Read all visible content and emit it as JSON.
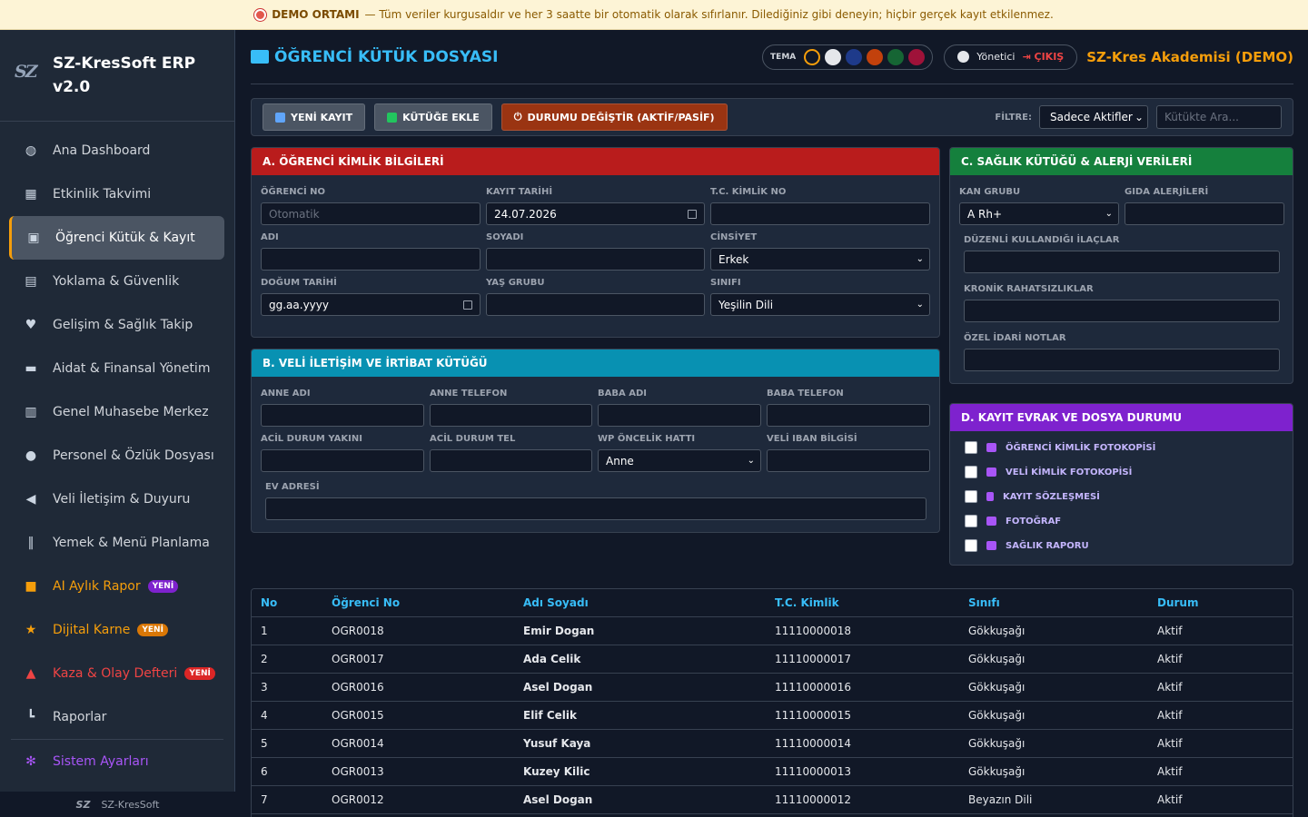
{
  "banner": {
    "title": "DEMO ORTAMI",
    "text": "— Tüm veriler kurgusaldır ve her 3 saatte bir otomatik olarak sıfırlanır. Dilediğiniz gibi deneyin; hiçbir gerçek kayıt etkilenmez."
  },
  "app": {
    "title": "SZ-KresSoft ERP v2.0",
    "footer": "SZ-KresSoft"
  },
  "sidebar": {
    "items": [
      {
        "label": "Ana Dashboard",
        "icon": "dashboard-icon"
      },
      {
        "label": "Etkinlik Takvimi",
        "icon": "calendar-icon"
      },
      {
        "label": "Öğrenci Kütük & Kayıt",
        "icon": "student-icon"
      },
      {
        "label": "Yoklama & Güvenlik",
        "icon": "id-badge-icon"
      },
      {
        "label": "Gelişim & Sağlık Takip",
        "icon": "heartbeat-icon"
      },
      {
        "label": "Aidat & Finansal Yönetim",
        "icon": "money-card-icon"
      },
      {
        "label": "Genel Muhasebe Merkez",
        "icon": "calculator-icon"
      },
      {
        "label": "Personel & Özlük Dosyası",
        "icon": "user-icon"
      },
      {
        "label": "Veli İletişim & Duyuru",
        "icon": "megaphone-icon"
      },
      {
        "label": "Yemek & Menü Planlama",
        "icon": "utensils-icon"
      },
      {
        "label": "AI Aylık Rapor",
        "icon": "robot-icon",
        "badge": "YENİ"
      },
      {
        "label": "Dijital Karne",
        "icon": "star-icon",
        "badge": "YENİ"
      },
      {
        "label": "Kaza & Olay Defteri",
        "icon": "warning-icon",
        "badge": "YENİ"
      },
      {
        "label": "Raporlar",
        "icon": "chart-icon"
      },
      {
        "label": "Sistem Ayarları",
        "icon": "cogs-icon"
      }
    ]
  },
  "header": {
    "title": "ÖĞRENCİ KÜTÜK DOSYASI",
    "theme_label": "TEMA",
    "user": "Yönetici",
    "logout": "ÇIKIŞ",
    "org": "SZ-Kres Akademisi (DEMO)"
  },
  "theme_colors": [
    "#111827",
    "#e5e7eb",
    "#1e3a8a",
    "#c2410c",
    "#166534",
    "#9f1239"
  ],
  "toolbar": {
    "new": "YENİ KAYIT",
    "save": "KÜTÜĞE EKLE",
    "toggle": "DURUMU DEĞİŞTİR (AKTİF/PASİF)",
    "filter_label": "FİLTRE:",
    "filter_value": "Sadece Aktifler",
    "search_placeholder": "Kütükte Ara..."
  },
  "panel_a": {
    "title": "A. ÖĞRENCİ KİMLİK BİLGİLERİ",
    "color": "#b91c1c",
    "ogrenci_no": "ÖĞRENCİ NO",
    "ogrenci_no_ph": "Otomatik",
    "kayit_tarihi": "KAYIT TARİHİ",
    "kayit_tarihi_val": "24.07.2026",
    "tc": "T.C. KİMLİK NO",
    "adi": "ADI",
    "soyadi": "SOYADI",
    "cinsiyet": "CİNSİYET",
    "cinsiyet_val": "Erkek",
    "dogum": "DOĞUM TARİHİ",
    "dogum_val": "gg.aa.yyyy",
    "yas": "YAŞ GRUBU",
    "sinif": "SINIFI",
    "sinif_val": "Yeşilin Dili"
  },
  "panel_b": {
    "title": "B. VELİ İLETİŞİM VE İRTİBAT KÜTÜĞÜ",
    "color": "#0891b2",
    "anne_adi": "ANNE ADI",
    "anne_tel": "ANNE TELEFON",
    "baba_adi": "BABA ADI",
    "baba_tel": "BABA TELEFON",
    "acil_yakin": "ACİL DURUM YAKINI",
    "acil_tel": "ACİL DURUM TEL",
    "wp": "WP ÖNCELİK HATTI",
    "wp_val": "Anne",
    "iban": "VELİ IBAN BİLGİSİ",
    "adres": "EV ADRESİ"
  },
  "panel_c": {
    "title": "C. SAĞLIK KÜTÜĞÜ & ALERJİ VERİLERİ",
    "color": "#15803d",
    "kan": "KAN GRUBU",
    "kan_val": "A Rh+",
    "gida": "GIDA ALERJİLERİ",
    "ilac": "DÜZENLİ KULLANDIĞI İLAÇLAR",
    "kronik": "KRONİK RAHATSIZLIKLAR",
    "notlar": "ÖZEL İDARİ NOTLAR"
  },
  "panel_d": {
    "title": "D. KAYIT EVRAK VE DOSYA DURUMU",
    "color": "#7e22ce",
    "items": [
      "ÖĞRENCİ KİMLİK FOTOKOPİSİ",
      "VELİ KİMLİK FOTOKOPİSİ",
      "KAYIT SÖZLEŞMESİ",
      "FOTOĞRAF",
      "SAĞLIK RAPORU"
    ]
  },
  "table": {
    "headers": [
      "No",
      "Öğrenci No",
      "Adı Soyadı",
      "T.C. Kimlik",
      "Sınıfı",
      "Durum"
    ],
    "rows": [
      [
        "1",
        "OGR0018",
        "Emir Dogan",
        "11110000018",
        "Gökkuşağı",
        "Aktif"
      ],
      [
        "2",
        "OGR0017",
        "Ada Celik",
        "11110000017",
        "Gökkuşağı",
        "Aktif"
      ],
      [
        "3",
        "OGR0016",
        "Asel Dogan",
        "11110000016",
        "Gökkuşağı",
        "Aktif"
      ],
      [
        "4",
        "OGR0015",
        "Elif Celik",
        "11110000015",
        "Gökkuşağı",
        "Aktif"
      ],
      [
        "5",
        "OGR0014",
        "Yusuf Kaya",
        "11110000014",
        "Gökkuşağı",
        "Aktif"
      ],
      [
        "6",
        "OGR0013",
        "Kuzey Kilic",
        "11110000013",
        "Gökkuşağı",
        "Aktif"
      ],
      [
        "7",
        "OGR0012",
        "Asel Dogan",
        "11110000012",
        "Beyazın Dili",
        "Aktif"
      ]
    ]
  }
}
